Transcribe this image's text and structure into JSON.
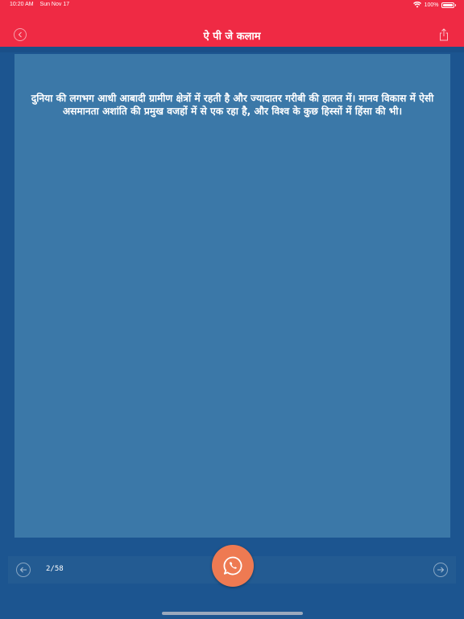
{
  "status_bar": {
    "time": "10:20 AM",
    "date": "Sun Nov 17",
    "battery": "100%"
  },
  "header": {
    "title": "ऐ पी जे कलाम",
    "back_icon": "chevron-left-icon",
    "share_icon": "share-icon"
  },
  "content": {
    "quote": "दुनिया की लगभग आधी आबादी ग्रामीण क्षेत्रों में रहती है और ज्यादातर गरीबी की हालत में। मानव विकास में ऐसी असमानता अशांति की प्रमुख वजहों में से एक रहा है, और विश्व के कुछ हिस्सों में हिंसा की भी।"
  },
  "footer": {
    "page_counter": "2/58",
    "prev_icon": "arrow-left-icon",
    "next_icon": "arrow-right-icon",
    "share_whatsapp_icon": "whatsapp-icon"
  },
  "colors": {
    "header_bg": "#ef2a44",
    "page_bg": "#1c5590",
    "card_bg": "#3b78a8",
    "fab_bg": "#ee7a52"
  }
}
